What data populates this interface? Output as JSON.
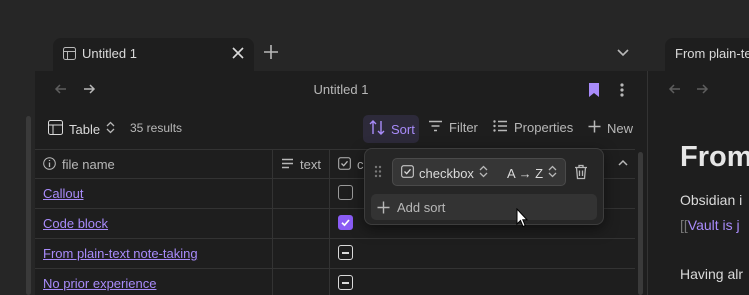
{
  "tabs": [
    {
      "title": "Untitled 1",
      "active": true
    },
    {
      "title": "From plain-te",
      "active": false
    }
  ],
  "view": {
    "title": "Untitled 1"
  },
  "toolbar": {
    "layout_label": "Table",
    "results": "35 results",
    "sort_label": "Sort",
    "filter_label": "Filter",
    "properties_label": "Properties",
    "new_label": "New"
  },
  "table": {
    "columns": [
      {
        "label": "file name",
        "icon": "info-icon"
      },
      {
        "label": "text",
        "icon": "text-lines-icon"
      },
      {
        "label": "ch",
        "icon": "checkbox-icon"
      }
    ],
    "rows": [
      {
        "name": "Callout",
        "checkbox": "unchecked"
      },
      {
        "name": "Code block",
        "checkbox": "checked"
      },
      {
        "name": "From plain-text note-taking",
        "checkbox": "indeterminate"
      },
      {
        "name": "No prior experience",
        "checkbox": "indeterminate"
      }
    ]
  },
  "sort_popup": {
    "property": "checkbox",
    "direction": "A → Z",
    "add_label": "Add sort"
  },
  "right_pane": {
    "heading": "From",
    "para1": "Obsidian i",
    "link_open": "[[",
    "link_text": "Vault is j",
    "para2": "Having alr"
  },
  "colors": {
    "accent": "#a88bfa",
    "checkbox_checked": "#8a5cf5",
    "background": "#1e1e1e"
  }
}
